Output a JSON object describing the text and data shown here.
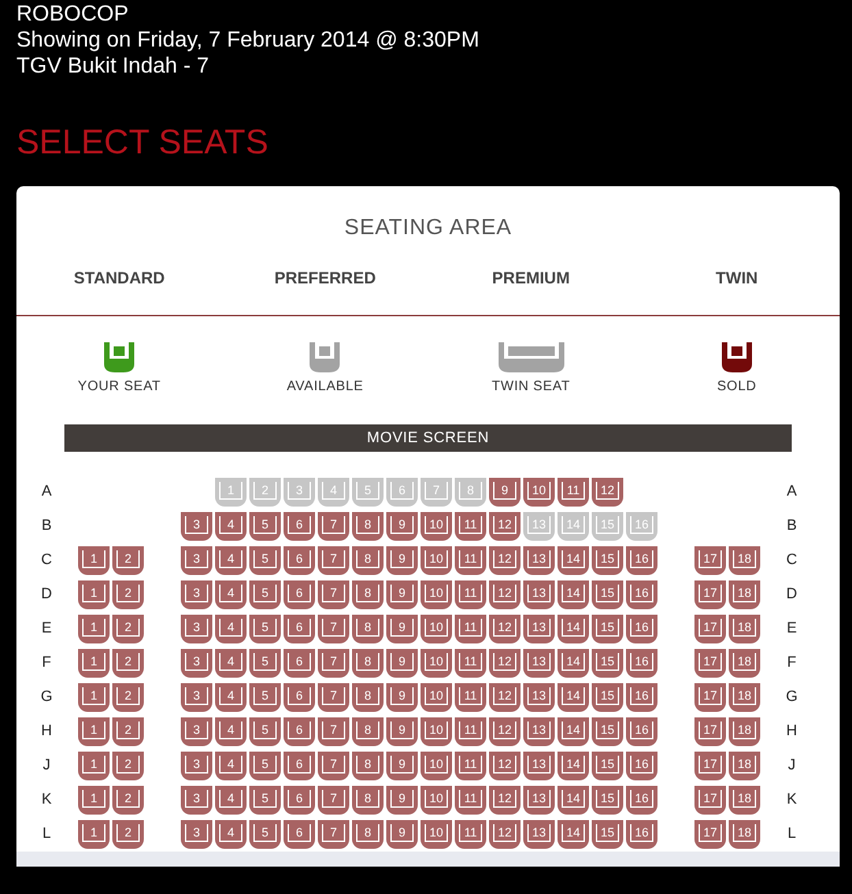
{
  "movie": {
    "title": "ROBOCOP",
    "showtime": "Showing on Friday, 7 February 2014 @ 8:30PM",
    "venue": "TGV Bukit Indah - 7"
  },
  "heading": "SELECT SEATS",
  "seating_area": {
    "title": "SEATING AREA",
    "tabs": [
      {
        "label": "STANDARD"
      },
      {
        "label": "PREFERRED"
      },
      {
        "label": "PREMIUM"
      },
      {
        "label": "TWIN"
      }
    ],
    "legend": [
      {
        "kind": "yours",
        "label": "YOUR SEAT"
      },
      {
        "kind": "available",
        "label": "AVAILABLE"
      },
      {
        "kind": "twin",
        "label": "TWIN SEAT"
      },
      {
        "kind": "sold",
        "label": "SOLD"
      }
    ],
    "screen": "MOVIE SCREEN",
    "rows": [
      {
        "label_left": "A",
        "label_right": "A",
        "left": [],
        "middle": [
          {
            "number": "1",
            "sold": false
          },
          {
            "number": "2",
            "sold": false
          },
          {
            "number": "3",
            "sold": false
          },
          {
            "number": "4",
            "sold": false
          },
          {
            "number": "5",
            "sold": false
          },
          {
            "number": "6",
            "sold": false
          },
          {
            "number": "7",
            "sold": false
          },
          {
            "number": "8",
            "sold": false
          },
          {
            "number": "9",
            "sold": true
          },
          {
            "number": "10",
            "sold": true
          },
          {
            "number": "11",
            "sold": true
          },
          {
            "number": "12",
            "sold": true
          }
        ],
        "right": []
      },
      {
        "label_left": "B",
        "label_right": "B",
        "left": [],
        "middle": [
          {
            "number": "3",
            "sold": true
          },
          {
            "number": "4",
            "sold": true
          },
          {
            "number": "5",
            "sold": true
          },
          {
            "number": "6",
            "sold": true
          },
          {
            "number": "7",
            "sold": true
          },
          {
            "number": "8",
            "sold": true
          },
          {
            "number": "9",
            "sold": true
          },
          {
            "number": "10",
            "sold": true
          },
          {
            "number": "11",
            "sold": true
          },
          {
            "number": "12",
            "sold": true
          },
          {
            "number": "13",
            "sold": false
          },
          {
            "number": "14",
            "sold": false
          },
          {
            "number": "15",
            "sold": false
          },
          {
            "number": "16",
            "sold": false
          }
        ],
        "right": []
      },
      {
        "label_left": "C",
        "label_right": "C",
        "left": [
          {
            "number": "1",
            "sold": true
          },
          {
            "number": "2",
            "sold": true
          }
        ],
        "middle": [
          {
            "number": "3",
            "sold": true
          },
          {
            "number": "4",
            "sold": true
          },
          {
            "number": "5",
            "sold": true
          },
          {
            "number": "6",
            "sold": true
          },
          {
            "number": "7",
            "sold": true
          },
          {
            "number": "8",
            "sold": true
          },
          {
            "number": "9",
            "sold": true
          },
          {
            "number": "10",
            "sold": true
          },
          {
            "number": "11",
            "sold": true
          },
          {
            "number": "12",
            "sold": true
          },
          {
            "number": "13",
            "sold": true
          },
          {
            "number": "14",
            "sold": true
          },
          {
            "number": "15",
            "sold": true
          },
          {
            "number": "16",
            "sold": true
          }
        ],
        "right": [
          {
            "number": "17",
            "sold": true
          },
          {
            "number": "18",
            "sold": true
          }
        ]
      },
      {
        "label_left": "D",
        "label_right": "D",
        "left": [
          {
            "number": "1",
            "sold": true
          },
          {
            "number": "2",
            "sold": true
          }
        ],
        "middle": [
          {
            "number": "3",
            "sold": true
          },
          {
            "number": "4",
            "sold": true
          },
          {
            "number": "5",
            "sold": true
          },
          {
            "number": "6",
            "sold": true
          },
          {
            "number": "7",
            "sold": true
          },
          {
            "number": "8",
            "sold": true
          },
          {
            "number": "9",
            "sold": true
          },
          {
            "number": "10",
            "sold": true
          },
          {
            "number": "11",
            "sold": true
          },
          {
            "number": "12",
            "sold": true
          },
          {
            "number": "13",
            "sold": true
          },
          {
            "number": "14",
            "sold": true
          },
          {
            "number": "15",
            "sold": true
          },
          {
            "number": "16",
            "sold": true
          }
        ],
        "right": [
          {
            "number": "17",
            "sold": true
          },
          {
            "number": "18",
            "sold": true
          }
        ]
      },
      {
        "label_left": "E",
        "label_right": "E",
        "left": [
          {
            "number": "1",
            "sold": true
          },
          {
            "number": "2",
            "sold": true
          }
        ],
        "middle": [
          {
            "number": "3",
            "sold": true
          },
          {
            "number": "4",
            "sold": true
          },
          {
            "number": "5",
            "sold": true
          },
          {
            "number": "6",
            "sold": true
          },
          {
            "number": "7",
            "sold": true
          },
          {
            "number": "8",
            "sold": true
          },
          {
            "number": "9",
            "sold": true
          },
          {
            "number": "10",
            "sold": true
          },
          {
            "number": "11",
            "sold": true
          },
          {
            "number": "12",
            "sold": true
          },
          {
            "number": "13",
            "sold": true
          },
          {
            "number": "14",
            "sold": true
          },
          {
            "number": "15",
            "sold": true
          },
          {
            "number": "16",
            "sold": true
          }
        ],
        "right": [
          {
            "number": "17",
            "sold": true
          },
          {
            "number": "18",
            "sold": true
          }
        ]
      },
      {
        "label_left": "F",
        "label_right": "F",
        "left": [
          {
            "number": "1",
            "sold": true
          },
          {
            "number": "2",
            "sold": true
          }
        ],
        "middle": [
          {
            "number": "3",
            "sold": true
          },
          {
            "number": "4",
            "sold": true
          },
          {
            "number": "5",
            "sold": true
          },
          {
            "number": "6",
            "sold": true
          },
          {
            "number": "7",
            "sold": true
          },
          {
            "number": "8",
            "sold": true
          },
          {
            "number": "9",
            "sold": true
          },
          {
            "number": "10",
            "sold": true
          },
          {
            "number": "11",
            "sold": true
          },
          {
            "number": "12",
            "sold": true
          },
          {
            "number": "13",
            "sold": true
          },
          {
            "number": "14",
            "sold": true
          },
          {
            "number": "15",
            "sold": true
          },
          {
            "number": "16",
            "sold": true
          }
        ],
        "right": [
          {
            "number": "17",
            "sold": true
          },
          {
            "number": "18",
            "sold": true
          }
        ]
      },
      {
        "label_left": "G",
        "label_right": "G",
        "left": [
          {
            "number": "1",
            "sold": true
          },
          {
            "number": "2",
            "sold": true
          }
        ],
        "middle": [
          {
            "number": "3",
            "sold": true
          },
          {
            "number": "4",
            "sold": true
          },
          {
            "number": "5",
            "sold": true
          },
          {
            "number": "6",
            "sold": true
          },
          {
            "number": "7",
            "sold": true
          },
          {
            "number": "8",
            "sold": true
          },
          {
            "number": "9",
            "sold": true
          },
          {
            "number": "10",
            "sold": true
          },
          {
            "number": "11",
            "sold": true
          },
          {
            "number": "12",
            "sold": true
          },
          {
            "number": "13",
            "sold": true
          },
          {
            "number": "14",
            "sold": true
          },
          {
            "number": "15",
            "sold": true
          },
          {
            "number": "16",
            "sold": true
          }
        ],
        "right": [
          {
            "number": "17",
            "sold": true
          },
          {
            "number": "18",
            "sold": true
          }
        ]
      },
      {
        "label_left": "H",
        "label_right": "H",
        "left": [
          {
            "number": "1",
            "sold": true
          },
          {
            "number": "2",
            "sold": true
          }
        ],
        "middle": [
          {
            "number": "3",
            "sold": true
          },
          {
            "number": "4",
            "sold": true
          },
          {
            "number": "5",
            "sold": true
          },
          {
            "number": "6",
            "sold": true
          },
          {
            "number": "7",
            "sold": true
          },
          {
            "number": "8",
            "sold": true
          },
          {
            "number": "9",
            "sold": true
          },
          {
            "number": "10",
            "sold": true
          },
          {
            "number": "11",
            "sold": true
          },
          {
            "number": "12",
            "sold": true
          },
          {
            "number": "13",
            "sold": true
          },
          {
            "number": "14",
            "sold": true
          },
          {
            "number": "15",
            "sold": true
          },
          {
            "number": "16",
            "sold": true
          }
        ],
        "right": [
          {
            "number": "17",
            "sold": true
          },
          {
            "number": "18",
            "sold": true
          }
        ]
      },
      {
        "label_left": "J",
        "label_right": "J",
        "left": [
          {
            "number": "1",
            "sold": true
          },
          {
            "number": "2",
            "sold": true
          }
        ],
        "middle": [
          {
            "number": "3",
            "sold": true
          },
          {
            "number": "4",
            "sold": true
          },
          {
            "number": "5",
            "sold": true
          },
          {
            "number": "6",
            "sold": true
          },
          {
            "number": "7",
            "sold": true
          },
          {
            "number": "8",
            "sold": true
          },
          {
            "number": "9",
            "sold": true
          },
          {
            "number": "10",
            "sold": true
          },
          {
            "number": "11",
            "sold": true
          },
          {
            "number": "12",
            "sold": true
          },
          {
            "number": "13",
            "sold": true
          },
          {
            "number": "14",
            "sold": true
          },
          {
            "number": "15",
            "sold": true
          },
          {
            "number": "16",
            "sold": true
          }
        ],
        "right": [
          {
            "number": "17",
            "sold": true
          },
          {
            "number": "18",
            "sold": true
          }
        ]
      },
      {
        "label_left": "K",
        "label_right": "K",
        "left": [
          {
            "number": "1",
            "sold": true
          },
          {
            "number": "2",
            "sold": true
          }
        ],
        "middle": [
          {
            "number": "3",
            "sold": true
          },
          {
            "number": "4",
            "sold": true
          },
          {
            "number": "5",
            "sold": true
          },
          {
            "number": "6",
            "sold": true
          },
          {
            "number": "7",
            "sold": true
          },
          {
            "number": "8",
            "sold": true
          },
          {
            "number": "9",
            "sold": true
          },
          {
            "number": "10",
            "sold": true
          },
          {
            "number": "11",
            "sold": true
          },
          {
            "number": "12",
            "sold": true
          },
          {
            "number": "13",
            "sold": true
          },
          {
            "number": "14",
            "sold": true
          },
          {
            "number": "15",
            "sold": true
          },
          {
            "number": "16",
            "sold": true
          }
        ],
        "right": [
          {
            "number": "17",
            "sold": true
          },
          {
            "number": "18",
            "sold": true
          }
        ]
      },
      {
        "label_left": "L",
        "label_right": "L",
        "left": [
          {
            "number": "1",
            "sold": true
          },
          {
            "number": "2",
            "sold": true
          }
        ],
        "middle": [
          {
            "number": "3",
            "sold": true
          },
          {
            "number": "4",
            "sold": true
          },
          {
            "number": "5",
            "sold": true
          },
          {
            "number": "6",
            "sold": true
          },
          {
            "number": "7",
            "sold": true
          },
          {
            "number": "8",
            "sold": true
          },
          {
            "number": "9",
            "sold": true
          },
          {
            "number": "10",
            "sold": true
          },
          {
            "number": "11",
            "sold": true
          },
          {
            "number": "12",
            "sold": true
          },
          {
            "number": "13",
            "sold": true
          },
          {
            "number": "14",
            "sold": true
          },
          {
            "number": "15",
            "sold": true
          },
          {
            "number": "16",
            "sold": true
          }
        ],
        "right": [
          {
            "number": "17",
            "sold": true
          },
          {
            "number": "18",
            "sold": true
          }
        ]
      }
    ]
  }
}
